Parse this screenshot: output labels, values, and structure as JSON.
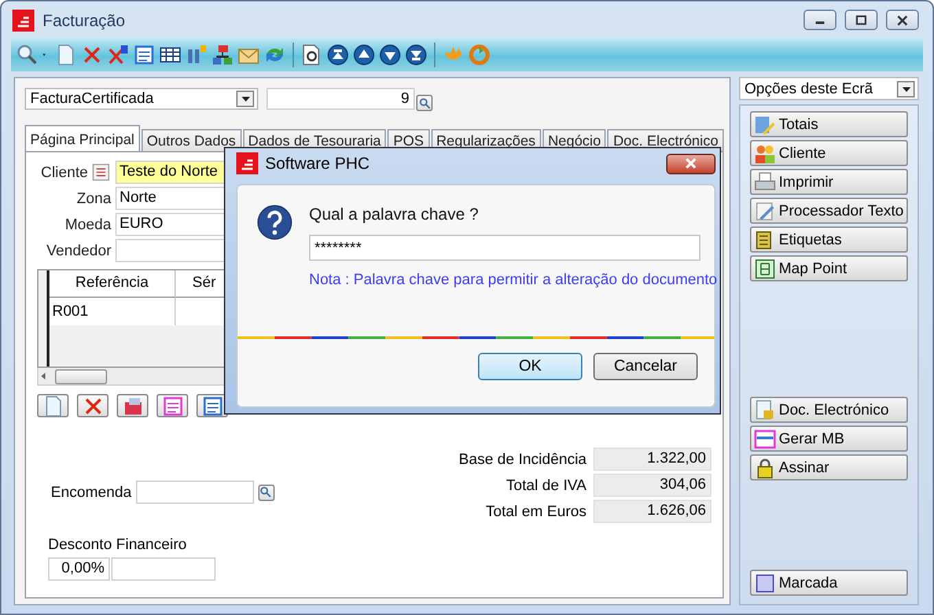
{
  "window": {
    "title": "Facturação"
  },
  "document": {
    "type": "FacturaCertificada",
    "number": "9"
  },
  "tabs": [
    {
      "label": "Página Principal",
      "selected": true
    },
    {
      "label": "Outros Dados",
      "selected": false
    },
    {
      "label": "Dados de Tesouraria",
      "selected": false
    },
    {
      "label": "POS",
      "selected": false
    },
    {
      "label": "Regularizações",
      "selected": false
    },
    {
      "label": "Negócio",
      "selected": false
    },
    {
      "label": "Doc. Electrónico",
      "selected": false
    }
  ],
  "fields": [
    {
      "label": "Cliente",
      "value": "Teste do Norte",
      "highlighted": true
    },
    {
      "label": "Zona",
      "value": "Norte",
      "highlighted": false
    },
    {
      "label": "Moeda",
      "value": "EURO",
      "highlighted": false
    },
    {
      "label": "Vendedor",
      "highlighted": false
    }
  ],
  "grid": {
    "columns": [
      "Referência",
      "Sér"
    ],
    "rows": [
      {
        "cells": [
          "R001"
        ]
      }
    ]
  },
  "totals": [
    {
      "label": "Base de Incidência",
      "value": "1.322,00"
    },
    {
      "label": "Total de IVA",
      "value": "304,06"
    },
    {
      "label": "Total em Euros",
      "value": "1.626,06"
    }
  ],
  "order": {
    "label": "Encomenda"
  },
  "discount": {
    "label": "Desconto Financeiro",
    "value": "0,00%"
  },
  "options": {
    "title": "Opções deste Ecrã",
    "groups": [
      [
        "Totais",
        "Cliente",
        "Imprimir",
        "Processador Texto",
        "Etiquetas",
        "Map Point"
      ],
      [
        "Doc. Electrónico",
        "Gerar MB",
        "Assinar"
      ],
      [
        "Marcada"
      ]
    ]
  },
  "dialog": {
    "title": "Software PHC",
    "question": "Qual a palavra chave ?",
    "value": "********",
    "note": "Nota : Palavra chave para permitir a alteração do documento",
    "buttons": [
      {
        "label": "OK",
        "selected": true
      },
      {
        "label": "Cancelar",
        "selected": false
      }
    ]
  }
}
